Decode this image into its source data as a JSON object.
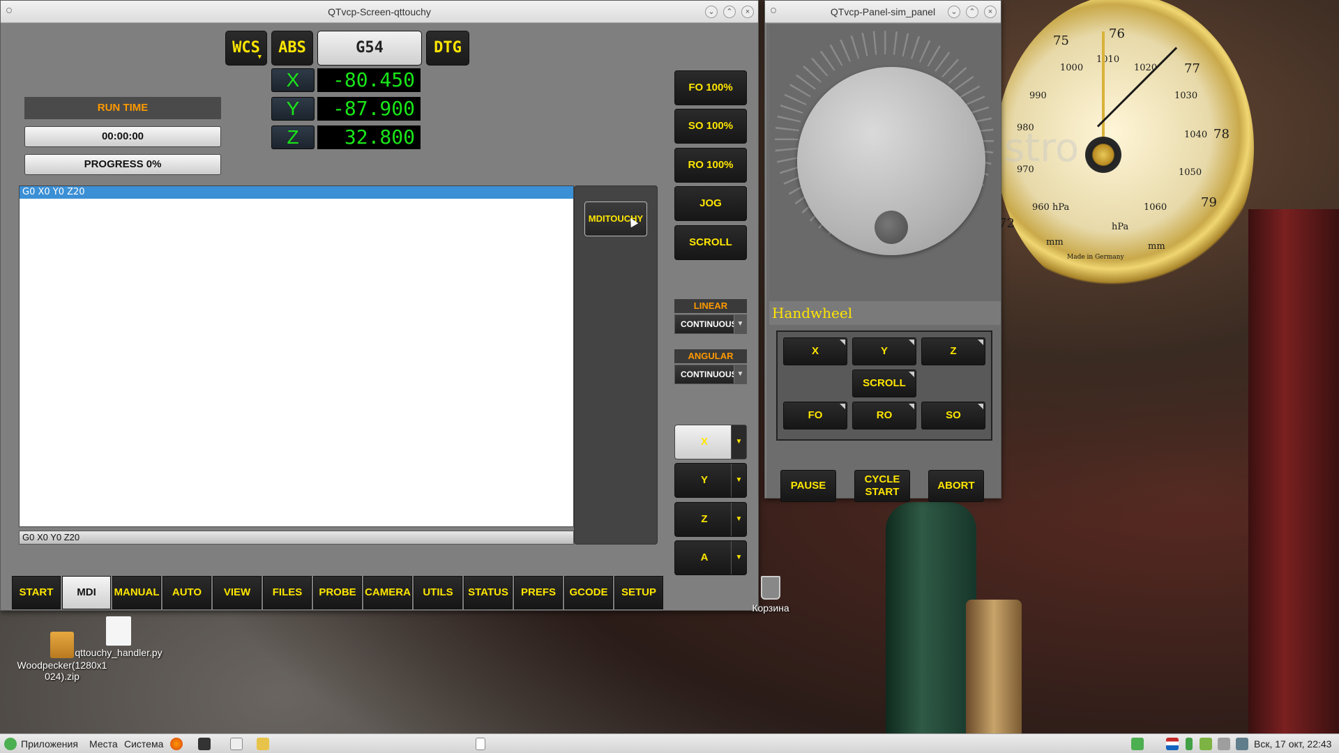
{
  "main_window": {
    "title": "QTvcp-Screen-qttouchy",
    "header": {
      "wcs": "WCS",
      "abs": "ABS",
      "coord": "G54",
      "dtg": "DTG"
    },
    "dro": [
      {
        "axis": "X",
        "value": "-80.450"
      },
      {
        "axis": "Y",
        "value": "-87.900"
      },
      {
        "axis": "Z",
        "value": "32.800"
      }
    ],
    "run_time_label": "RUN TIME",
    "run_time": "00:00:00",
    "progress": "PROGRESS 0%",
    "gcode_line": "G0 X0 Y0 Z20",
    "mdi_input": "G0 X0 Y0 Z20",
    "mdi_button": "MDITOUCHY",
    "overrides": [
      "FO 100%",
      "SO 100%",
      "RO 100%"
    ],
    "jog": "JOG",
    "scroll": "SCROLL",
    "linear_label": "LINEAR",
    "linear_mode": "CONTINUOUS",
    "angular_label": "ANGULAR",
    "angular_mode": "CONTINUOUS",
    "axis_select": [
      "X",
      "Y",
      "Z",
      "A"
    ],
    "tabs": [
      "START",
      "MDI",
      "MANUAL",
      "AUTO",
      "VIEW",
      "FILES",
      "PROBE",
      "CAMERA",
      "UTILS",
      "STATUS",
      "PREFS",
      "GCODE",
      "SETUP"
    ],
    "active_tab": "MDI"
  },
  "sim_panel": {
    "title": "QTvcp-Panel-sim_panel",
    "handwheel_label": "Handwheel",
    "axis_buttons": [
      "X",
      "Y",
      "Z"
    ],
    "scroll": "SCROLL",
    "override_buttons": [
      "FO",
      "RO",
      "SO"
    ],
    "pause": "PAUSE",
    "cycle_start_1": "CYCLE",
    "cycle_start_2": "START",
    "abort": "ABORT"
  },
  "desktop": {
    "trash": "Корзина",
    "file1_line1": "Woodpecker(1280x1",
    "file1_line2": "024).zip",
    "file2": "qttouchy_handler.py",
    "barometer_numbers": [
      "75",
      "76",
      "77",
      "78",
      "79",
      "72",
      "1000",
      "1010",
      "1020",
      "990",
      "980",
      "970",
      "960 hPa",
      "1030",
      "1040",
      "1050",
      "1060",
      "hPa",
      "mm",
      "mm",
      "Made in Germany"
    ]
  },
  "taskbar": {
    "apps": "Приложения",
    "places": "Места",
    "system": "Система",
    "clock": "Вск, 17 окт, 22:43"
  },
  "colors": {
    "accent_yellow": "#ffe600",
    "dro_green": "#19e619",
    "label_orange": "#ff9a00",
    "selection_blue": "#3a8fd5"
  }
}
